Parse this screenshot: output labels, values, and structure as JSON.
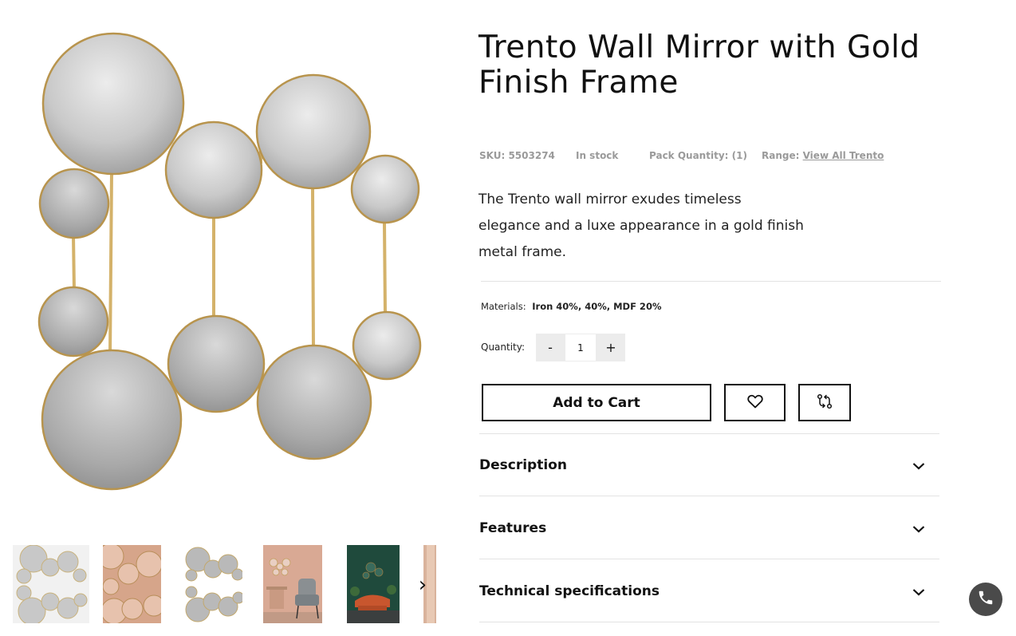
{
  "product": {
    "title": "Trento Wall Mirror with Gold Finish Frame",
    "sku": "SKU: 5503274",
    "stock": "In stock",
    "pack_quantity": "Pack Quantity: (1)",
    "range_label": "Range:",
    "range_link": "View All Trento",
    "description": "The Trento wall mirror exudes timeless elegance and a luxe appearance in a gold finish metal frame.",
    "materials_label": "Materials:",
    "materials_value": "Iron 40%, 40%, MDF 20%"
  },
  "quantity": {
    "label": "Quantity:",
    "minus": "-",
    "value": "1",
    "plus": "+"
  },
  "actions": {
    "add_to_cart": "Add to Cart",
    "wishlist_icon": "heart-icon",
    "compare_icon": "compare-arrows-icon"
  },
  "accordion": [
    {
      "label": "Description"
    },
    {
      "label": "Features"
    },
    {
      "label": "Technical specifications"
    }
  ],
  "gallery": {
    "next_arrow": "›",
    "thumbnails": [
      "mirror-white-background",
      "mirror-on-pink-wall",
      "mirror-product-shot",
      "mirror-in-living-room-with-chair",
      "mirror-on-green-wall-with-sofa",
      "mirror-partial-view"
    ]
  },
  "colors": {
    "gold_frame": "#c9a55e",
    "mirror_light": "#e2e2e2",
    "mirror_dark": "#9a9a9a",
    "button_border": "#111111",
    "phone_button": "#4a4a4a"
  },
  "floating": {
    "phone_icon": "phone-icon"
  }
}
